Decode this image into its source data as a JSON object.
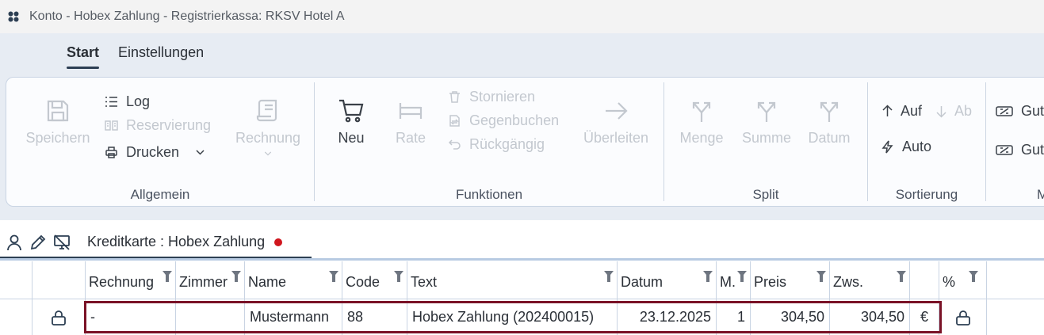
{
  "window": {
    "title": "Konto - Hobex Zahlung  - Registrierkassa: RKSV Hotel A"
  },
  "tabs": [
    {
      "label": "Start",
      "active": true
    },
    {
      "label": "Einstellungen",
      "active": false
    }
  ],
  "ribbon": {
    "allgemein": {
      "label": "Allgemein",
      "save": "Speichern",
      "log": "Log",
      "reservation": "Reservierung",
      "print": "Drucken",
      "invoice": "Rechnung"
    },
    "funktionen": {
      "label": "Funktionen",
      "new": "Neu",
      "rate": "Rate",
      "cancel": "Stornieren",
      "counterbook": "Gegenbuchen",
      "undo": "Rückgängig",
      "transfer": "Überleiten"
    },
    "split": {
      "label": "Split",
      "quantity": "Menge",
      "sum": "Summe",
      "date": "Datum"
    },
    "sortierung": {
      "label": "Sortierung",
      "asc": "Auf",
      "desc": "Ab",
      "auto": "Auto"
    },
    "more": {
      "voucher1": "Gut",
      "voucher2": "Gut",
      "label": "M"
    }
  },
  "doc_tab": {
    "label": "Kreditkarte :  Hobex Zahlung",
    "modified_color": "#d0161e"
  },
  "grid": {
    "columns": [
      "Rechnung",
      "Zimmer",
      "Name",
      "Code",
      "Text",
      "Datum",
      "M.",
      "Preis",
      "Zws.",
      "",
      "%"
    ],
    "row": {
      "invoice": "-",
      "room": "",
      "name": "Mustermann",
      "code": "88",
      "text": "Hobex Zahlung (202400015)",
      "date": "23.12.2025",
      "quantity": "1",
      "price": "304,50",
      "subtotal": "304,50",
      "currency": "€"
    }
  },
  "colors": {
    "accent": "#2d3f53",
    "selection": "#7a1226",
    "disabled": "#c3c8cf"
  }
}
